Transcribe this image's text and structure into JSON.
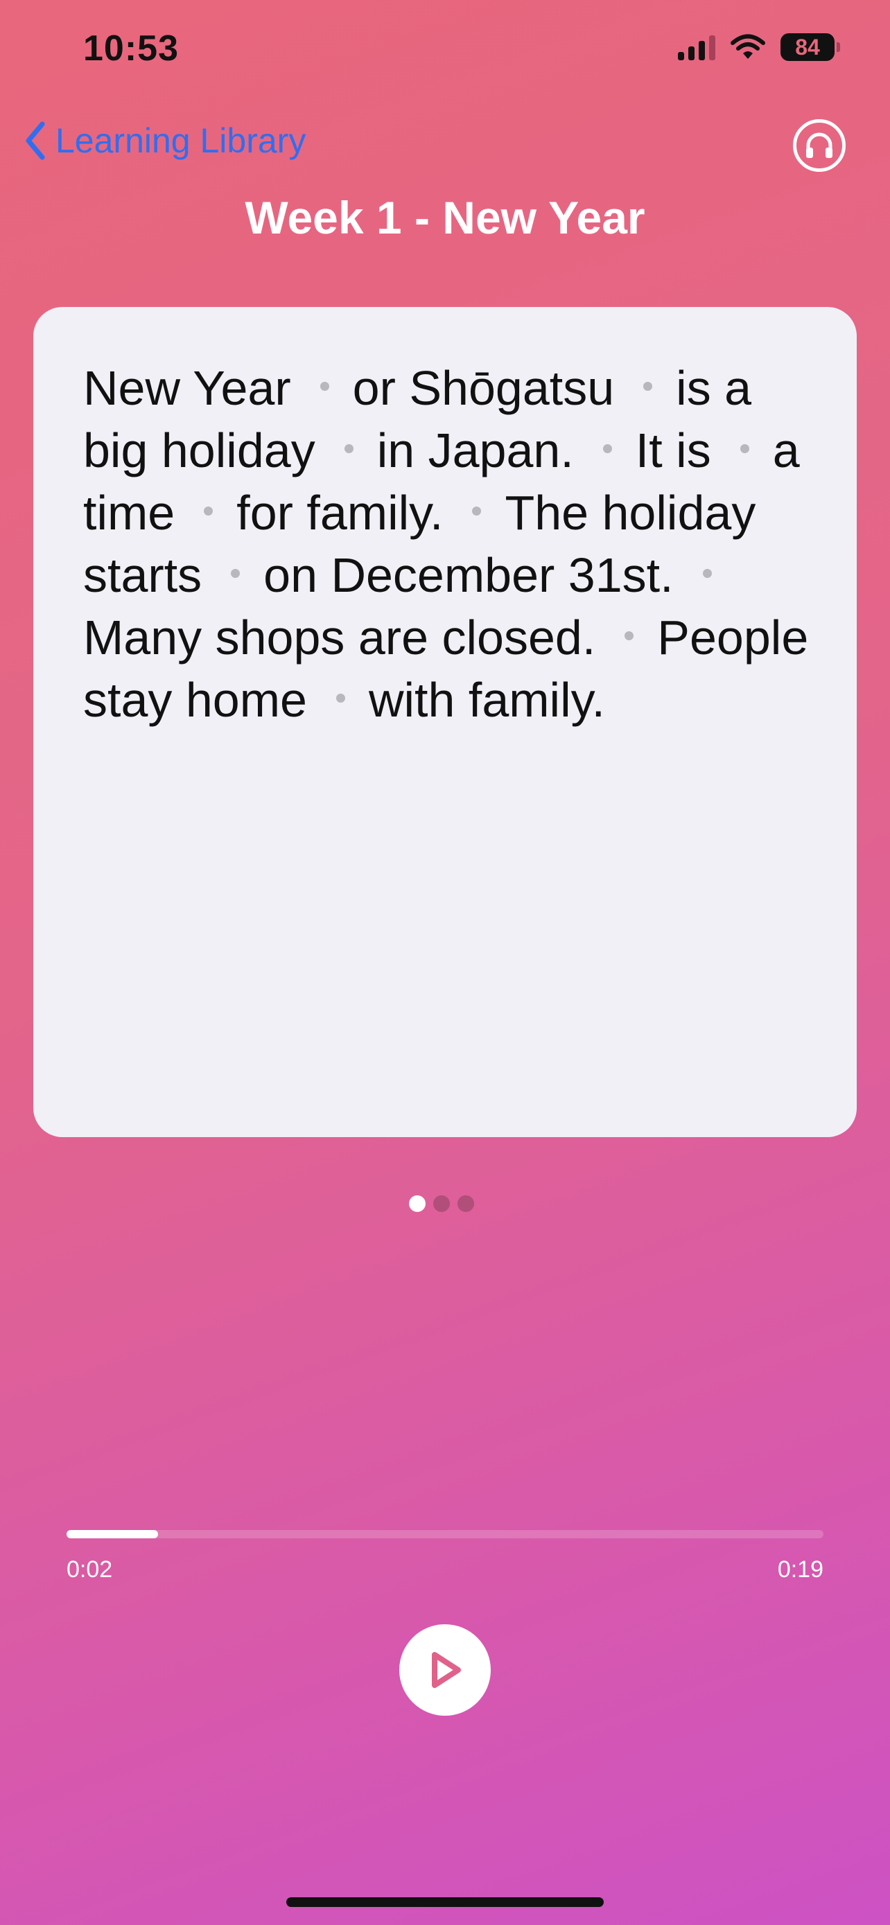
{
  "status_bar": {
    "time": "10:53",
    "battery": "84"
  },
  "nav": {
    "back_label": "Learning Library"
  },
  "title": "Week 1 - New Year",
  "passage": {
    "segments": [
      "New Year",
      "or Shōgatsu",
      "is a big holiday",
      "in Japan.",
      "It is",
      "a time",
      "for family.",
      "The holiday starts",
      "on December 31st.",
      "Many shops are closed.",
      "People stay home",
      "with family."
    ]
  },
  "pager": {
    "count": 3,
    "active": 0
  },
  "player": {
    "elapsed": "0:02",
    "total": "0:19",
    "progress": 0.1205
  },
  "colors": {
    "accent_link": "#2f6ef0",
    "card_bg": "#f1f0f6"
  },
  "icons": {
    "back": "chevron-left-icon",
    "headphones": "headphones-icon",
    "play": "play-icon"
  }
}
